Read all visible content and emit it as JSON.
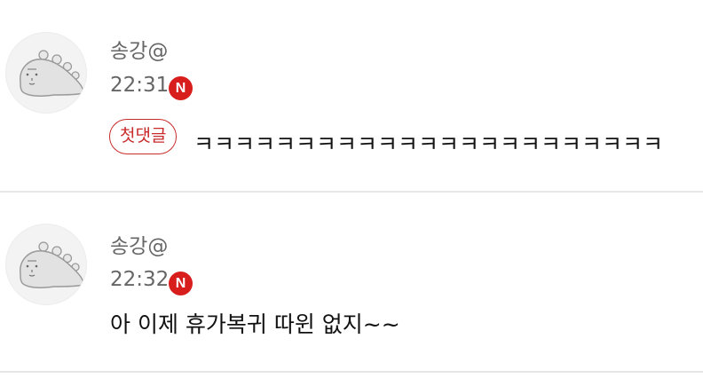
{
  "comments": [
    {
      "author": "송강@",
      "time": "22:31",
      "badge": "N",
      "first_label": "첫댓글",
      "text": "ㅋㅋㅋㅋㅋㅋㅋㅋㅋㅋㅋㅋㅋㅋㅋㅋㅋㅋㅋㅋㅋㅋㅋ"
    },
    {
      "author": "송강@",
      "time": "22:32",
      "badge": "N",
      "text": "아 이제 휴가복귀 따윈 없지~~"
    }
  ],
  "colors": {
    "badge_red": "#d81d1d",
    "first_badge_red": "#c92a2a",
    "meta_gray": "#666666",
    "divider": "#e6e6e6"
  },
  "icons": {
    "avatar": "dinosaur-avatar-icon",
    "new": "new-badge-icon"
  }
}
